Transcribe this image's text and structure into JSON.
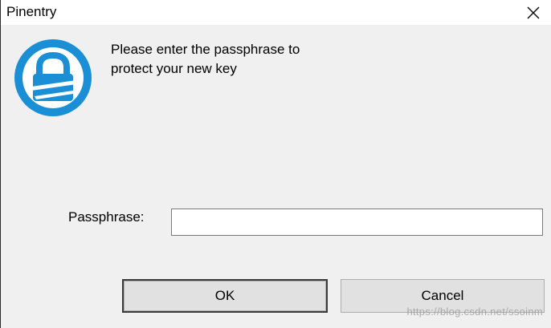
{
  "window": {
    "title": "Pinentry"
  },
  "icons": {
    "logo": "padlock-logo-icon",
    "close": "close-icon"
  },
  "colors": {
    "brand_blue": "#1a8fd6",
    "window_bg": "#f0f0f0",
    "titlebar_bg": "#ffffff",
    "button_bg": "#e1e1e1"
  },
  "dialog": {
    "description": "Please enter the passphrase to\nprotect your new key",
    "passphrase_label": "Passphrase:",
    "passphrase_value": ""
  },
  "buttons": {
    "ok_label": "OK",
    "cancel_label": "Cancel"
  },
  "watermark": {
    "text": "https://blog.csdn.net/ssoinm"
  }
}
